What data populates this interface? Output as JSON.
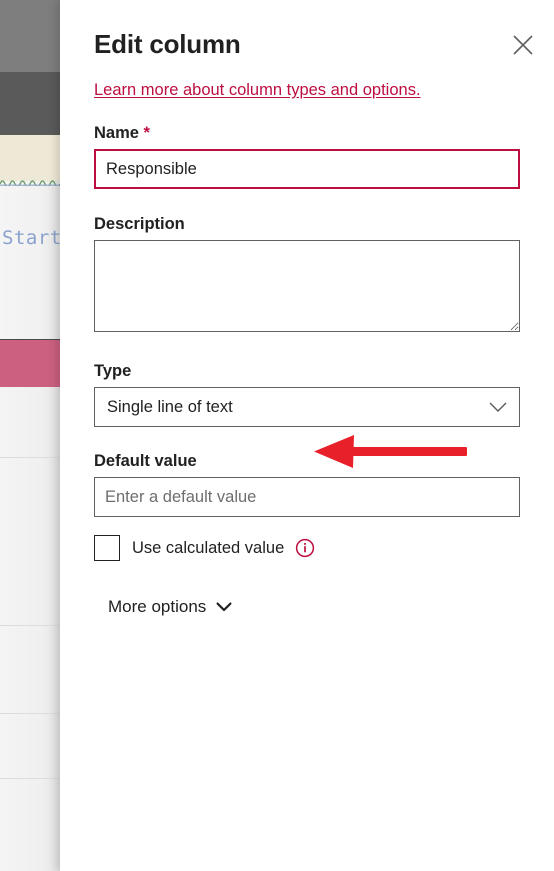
{
  "panel": {
    "title": "Edit column",
    "close_icon": "close-icon",
    "learn_more_link": "Learn more about column types and options.",
    "accent_color": "#bd0e40"
  },
  "fields": {
    "name": {
      "label": "Name",
      "required_marker": "*",
      "value": "Responsible",
      "placeholder": ""
    },
    "description": {
      "label": "Description",
      "value": "",
      "placeholder": ""
    },
    "type": {
      "label": "Type",
      "selected": "Single line of text",
      "chevron_icon": "chevron-down-icon"
    },
    "default_value": {
      "label": "Default value",
      "value": "",
      "placeholder": "Enter a default value"
    },
    "use_calculated_value": {
      "label": "Use calculated value",
      "checked": false,
      "info_icon": "info-icon"
    }
  },
  "more_options": {
    "label": "More options",
    "chevron_icon": "chevron-down-icon"
  },
  "annotation": {
    "arrow_color": "#e8202a",
    "arrow_direction": "left",
    "points_at": "type-select"
  },
  "backdrop": {
    "start_text": "Start"
  }
}
